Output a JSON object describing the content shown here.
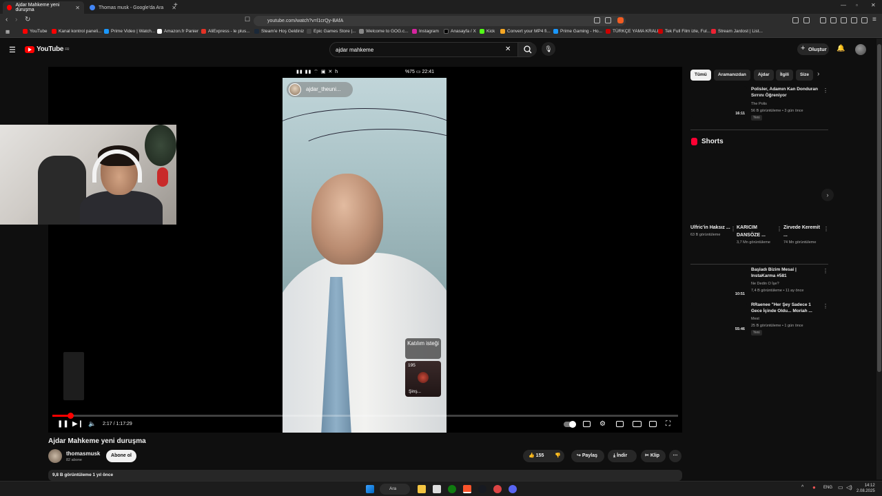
{
  "browser": {
    "tabs": [
      {
        "title": "Ajdar Mahkeme yeni duruşma",
        "active": true
      },
      {
        "title": "Thomas musk - Google'da Ara",
        "active": false
      }
    ],
    "url": "youtube.com/watch?v=l1crQy-BAfA",
    "bookmarks": [
      "YouTube",
      "Kanal kontrol paneli...",
      "Prime Video | Watch...",
      "Amazon.fr Panier",
      "AliExpress - le plus...",
      "Steam'e Hoş Geldiniz",
      "Epic Games Store |...",
      "Welcome to GOG.c...",
      "Instagram",
      "Anasayfa / X",
      "Kick",
      "Convert your MP4 fi...",
      "Prime Gaming - Ho...",
      "TÜRKÇE YAMA KRALI",
      "Tek Full Film izle, Ful...",
      "Stream Jardost | List..."
    ]
  },
  "youtube": {
    "logo_text": "YouTube",
    "logo_region": "FR",
    "search_value": "ajdar mahkeme",
    "create_label": "Oluştur"
  },
  "player": {
    "phone_time": "22:41",
    "phone_battery": "%75",
    "streamer_name": "ajdar_theuni...",
    "join_request": "Katılım isteği",
    "guest_count": "195",
    "guest_name": "Şinş...",
    "current_time": "2:17",
    "duration": "1:17:29",
    "time_display": "2:17 / 1:17:29",
    "progress_fraction": 0.029
  },
  "video": {
    "title": "Ajdar Mahkeme yeni duruşma",
    "channel": "thomasmusk",
    "subscribers": "82 abone",
    "subscribe_label": "Abone ol",
    "likes": "155",
    "share_label": "Paylaş",
    "download_label": "İndir",
    "clip_label": "Klip",
    "description_meta": "9,8 B görüntüleme   1 yıl önce"
  },
  "sidebar": {
    "chips": [
      "Tümü",
      "Aramanızdan",
      "Ajdar",
      "İlgili",
      "Size"
    ],
    "videos": [
      {
        "title": "Polisler, Adamın Kan Donduran Sırrını Öğreniyor",
        "channel": "The Polis",
        "meta": "56 B görüntüleme • 3 gün önce",
        "badge": "Yeni",
        "duration": "16:11"
      },
      {
        "title": "Başladı Bizim Mesai | InstaKarma #581",
        "channel": "Ne Dedin O İşe?",
        "meta": "7,4 B görüntüleme • 11 ay önce",
        "badge": "",
        "duration": "10:51"
      },
      {
        "title": "RRaenee \"Her Şey Sadece 1 Gece İçinde Oldu... Moriah ...",
        "channel": "Mest",
        "meta": "25 B görüntüleme • 1 gün önce",
        "badge": "Yeni",
        "duration": "55:46"
      }
    ],
    "shorts_title": "Shorts",
    "shorts": [
      {
        "title": "Ulfric'in Haksız ...",
        "views": "63 B görüntüleme"
      },
      {
        "title": "KARICIM DANSÖZE ...",
        "views": "3,7 Mn görüntüleme"
      },
      {
        "title": "Zirvede Keremit ...",
        "views": "74 Mn görüntüleme"
      }
    ]
  },
  "taskbar": {
    "search_label": "Ara",
    "language": "ENG",
    "time": "14:12",
    "date": "2.08.2025"
  },
  "colors": {
    "accent": "#ff0000",
    "background": "#0f0f0f",
    "surface": "#272727"
  }
}
